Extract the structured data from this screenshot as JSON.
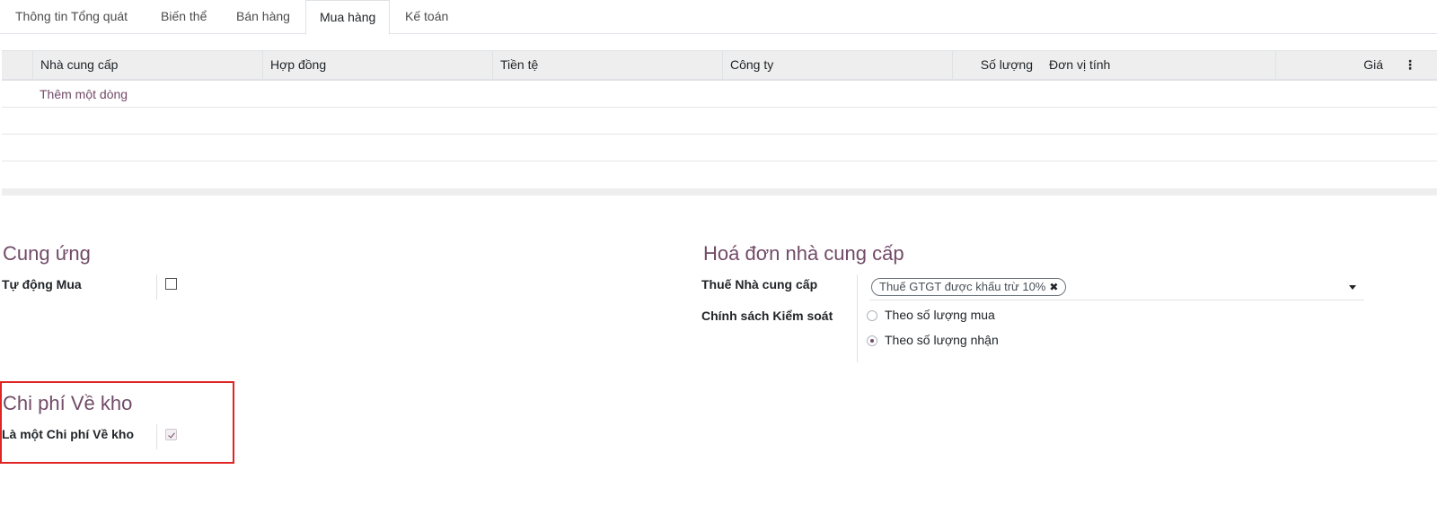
{
  "tabs": [
    {
      "label": "Thông tin Tổng quát"
    },
    {
      "label": "Biến thể"
    },
    {
      "label": "Bán hàng"
    },
    {
      "label": "Mua hàng"
    },
    {
      "label": "Kế toán"
    }
  ],
  "active_tab": "Mua hàng",
  "vendor_table": {
    "columns": [
      "Nhà cung cấp",
      "Hợp đồng",
      "Tiền tệ",
      "Công ty",
      "Số lượng",
      "Đơn vị tính",
      "Giá"
    ],
    "add_line_label": "Thêm một dòng",
    "options_icon": "kebab-menu-icon"
  },
  "procurement": {
    "title": "Cung ứng",
    "auto_buy_label": "Tự động Mua",
    "auto_buy_checked": false
  },
  "landed_cost": {
    "title": "Chi phí Về kho",
    "is_landed_cost_label": "Là một Chi phí Về kho",
    "is_landed_cost_checked": true
  },
  "vendor_bills": {
    "title": "Hoá đơn nhà cung cấp",
    "vendor_taxes_label": "Thuế Nhà cung cấp",
    "tax_tag": "Thuế GTGT được khấu trừ 10%",
    "tax_tag_remove": "✖",
    "control_policy_label": "Chính sách Kiểm soát",
    "control_policy_options": [
      "Theo số lượng mua",
      "Theo số lượng nhận"
    ],
    "control_policy_selected": "Theo số lượng nhận"
  },
  "colors": {
    "accent": "#714b67",
    "highlight_border": "#e02424"
  }
}
